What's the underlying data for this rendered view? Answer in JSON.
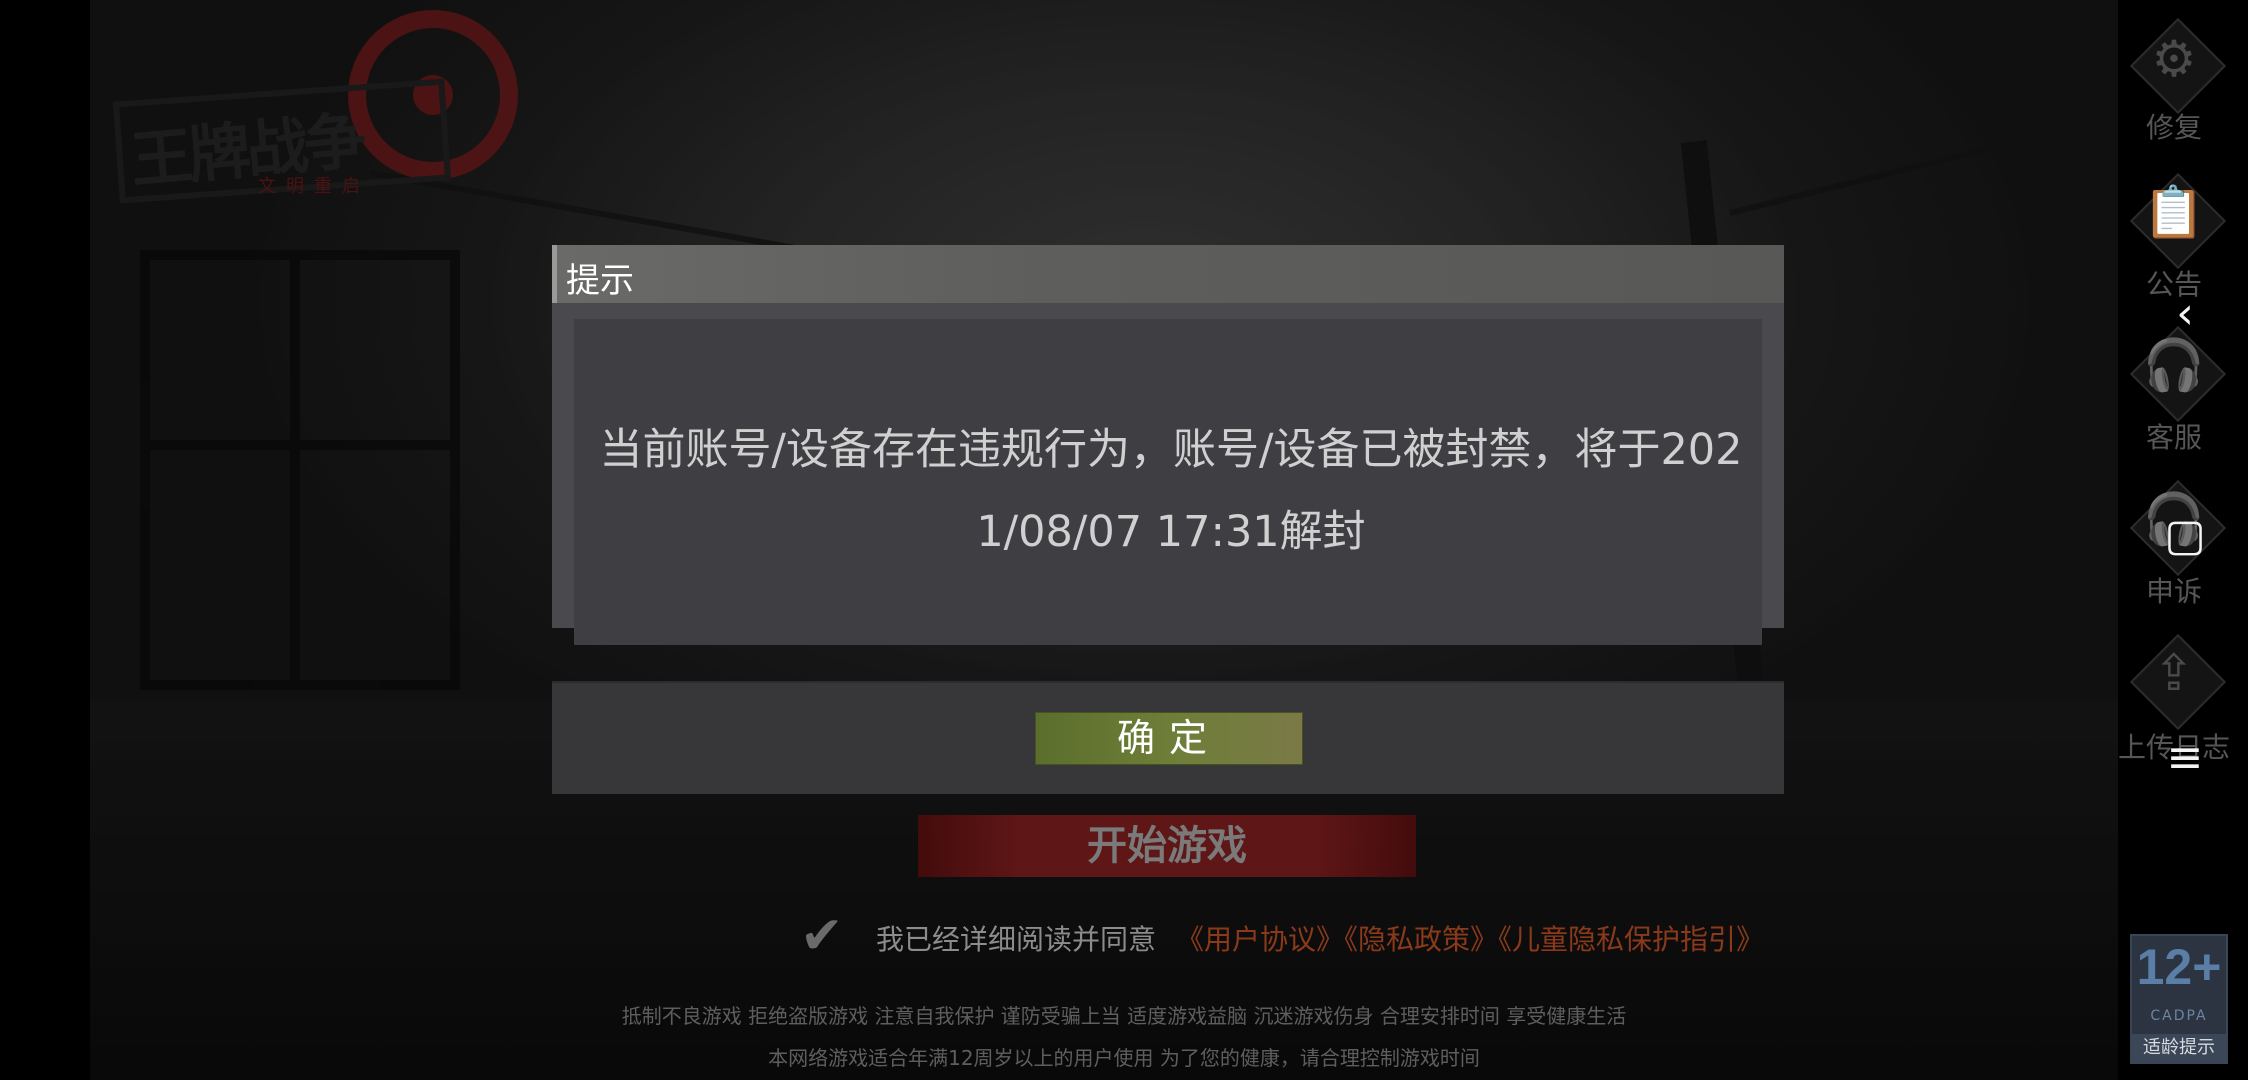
{
  "logo": {
    "title": "王牌战争",
    "subtitle": "文明重启"
  },
  "side_menu": {
    "items": [
      {
        "label": "修复",
        "icon": "gears-icon"
      },
      {
        "label": "公告",
        "icon": "clipboard-icon"
      },
      {
        "label": "客服",
        "icon": "headset-icon"
      },
      {
        "label": "申诉",
        "icon": "headset-icon"
      },
      {
        "label": "上传日志",
        "icon": "upload-icon"
      }
    ]
  },
  "nav": {
    "back": "‹",
    "home": "▢",
    "menu": "≡"
  },
  "dialog": {
    "title": "提示",
    "message_line1": "当前账号/设备存在违规行为，账号/设备已被封禁，将于202",
    "message_line2": "1/08/07 17:31解封",
    "confirm_label": "确定"
  },
  "start": {
    "label": "开始游戏"
  },
  "agreement": {
    "check": "✔",
    "text": "我已经详细阅读并同意",
    "links": "《用户协议》《隐私政策》《儿童隐私保护指引》"
  },
  "footer": {
    "line1": "抵制不良游戏 拒绝盗版游戏 注意自我保护 谨防受骗上当 适度游戏益脑 沉迷游戏伤身 合理安排时间 享受健康生活",
    "line2": "本网络游戏适合年满12周岁以上的用户使用   为了您的健康，请合理控制游戏时间"
  },
  "age_badge": {
    "rating": "12+",
    "org": "CADPA",
    "caption": "适龄提示"
  },
  "colors": {
    "dialog_bg": "#4a4a4e",
    "confirm_green": "#6e7e38",
    "start_red": "#5e1616",
    "link_orange": "#8a3a1a"
  }
}
